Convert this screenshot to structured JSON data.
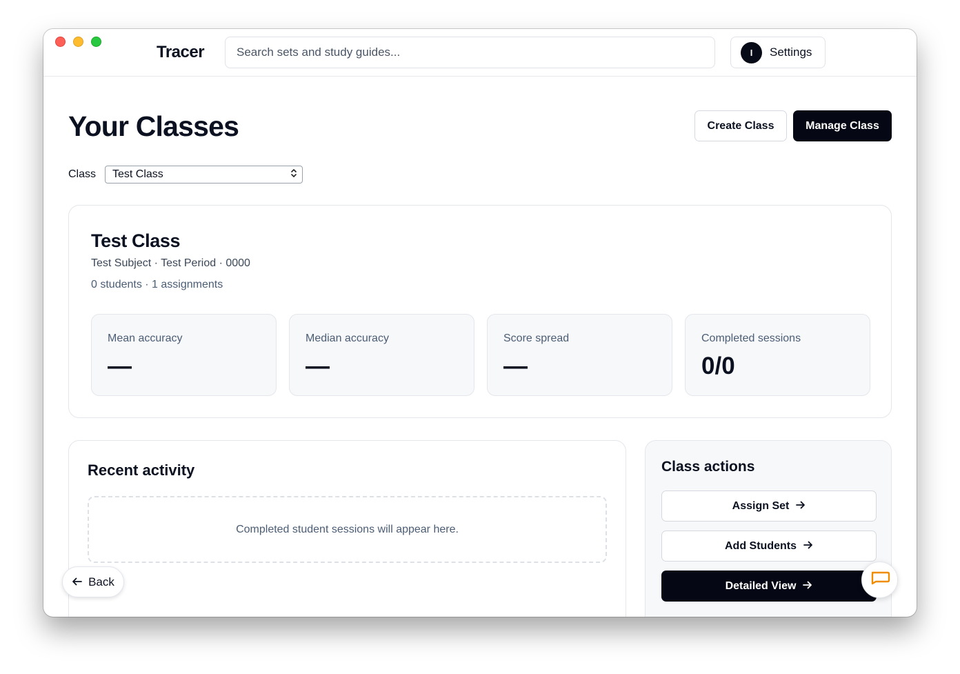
{
  "app": {
    "name": "Tracer"
  },
  "search": {
    "placeholder": "Search sets and study guides..."
  },
  "user": {
    "initial": "I",
    "settings_label": "Settings"
  },
  "page": {
    "title": "Your Classes",
    "create_label": "Create Class",
    "manage_label": "Manage Class"
  },
  "class_picker": {
    "label": "Class",
    "selected": "Test Class"
  },
  "class_card": {
    "name": "Test Class",
    "meta": "Test Subject · Test Period · 0000",
    "counts": "0 students · 1 assignments",
    "stats": [
      {
        "label": "Mean accuracy",
        "value": "—"
      },
      {
        "label": "Median accuracy",
        "value": "—"
      },
      {
        "label": "Score spread",
        "value": "—"
      },
      {
        "label": "Completed sessions",
        "value": "0/0"
      }
    ]
  },
  "activity": {
    "title": "Recent activity",
    "empty": "Completed student sessions will appear here."
  },
  "actions": {
    "title": "Class actions",
    "assign_set": "Assign Set",
    "add_students": "Add Students",
    "detailed_view": "Detailed View"
  },
  "nav": {
    "back_label": "Back"
  },
  "colors": {
    "accent_dark": "#050814",
    "chat_icon": "#f08c00"
  },
  "icons": {
    "back": "arrow-left-icon",
    "forward": "arrow-right-icon",
    "chat": "chat-bubble-icon",
    "select": "chevron-updown-icon"
  }
}
